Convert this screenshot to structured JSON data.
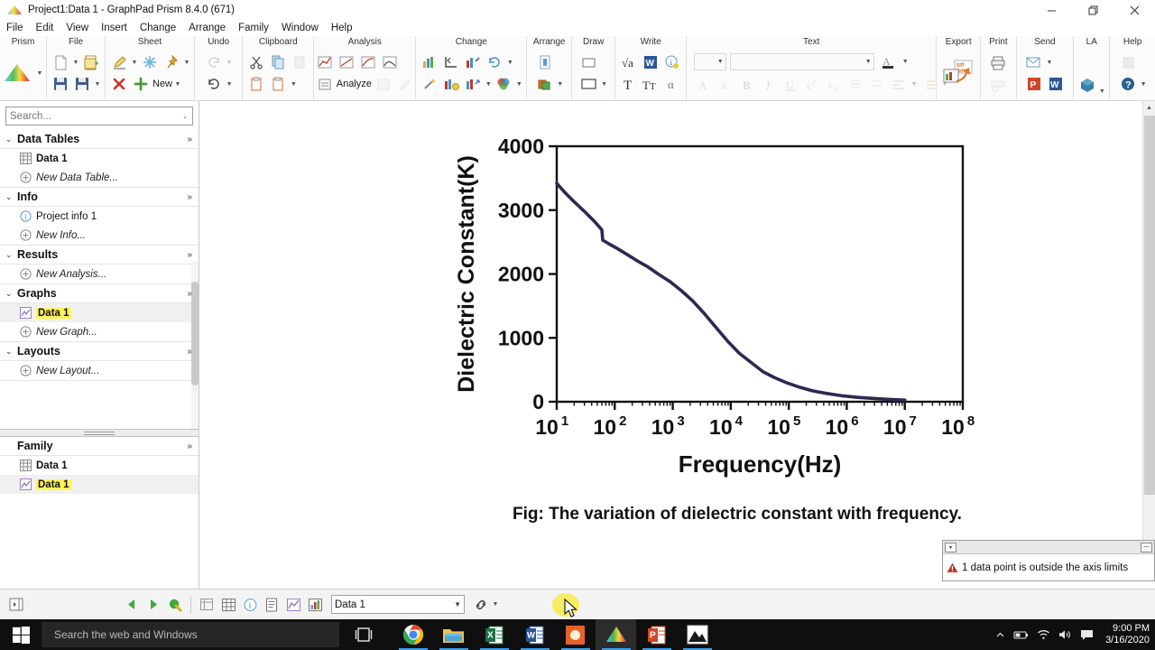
{
  "window": {
    "title": "Project1:Data 1 - GraphPad Prism 8.4.0 (671)",
    "minimize": "minimize-button",
    "restore": "restore-button",
    "close": "close-button"
  },
  "menubar": {
    "items": [
      "File",
      "Edit",
      "View",
      "Insert",
      "Change",
      "Arrange",
      "Family",
      "Window",
      "Help"
    ]
  },
  "ribbon": {
    "groups": [
      {
        "label": "Prism"
      },
      {
        "label": "File"
      },
      {
        "label": "Sheet",
        "new_label": "New"
      },
      {
        "label": "Undo"
      },
      {
        "label": "Clipboard"
      },
      {
        "label": "Analysis",
        "analyze_label": "Analyze"
      },
      {
        "label": "Change"
      },
      {
        "label": "Arrange"
      },
      {
        "label": "Draw"
      },
      {
        "label": "Write"
      },
      {
        "label": "Text"
      },
      {
        "label": "Export"
      },
      {
        "label": "Print"
      },
      {
        "label": "Send"
      },
      {
        "label": "LA"
      },
      {
        "label": "Help"
      }
    ],
    "font_name_value": "",
    "font_size_value": ""
  },
  "navigator": {
    "search": {
      "placeholder": "Search...",
      "value": ""
    },
    "sections": [
      {
        "title": "Data Tables",
        "rows": [
          {
            "label": "Data 1",
            "icon": "table-icon",
            "style": "bold"
          },
          {
            "label": "New Data Table...",
            "icon": "plus-circle-icon",
            "style": "new"
          }
        ]
      },
      {
        "title": "Info",
        "rows": [
          {
            "label": "Project info 1",
            "icon": "info-circle-icon",
            "style": "normal"
          },
          {
            "label": "New Info...",
            "icon": "plus-circle-icon",
            "style": "new"
          }
        ]
      },
      {
        "title": "Results",
        "rows": [
          {
            "label": "New Analysis...",
            "icon": "plus-circle-icon",
            "style": "new"
          }
        ]
      },
      {
        "title": "Graphs",
        "rows": [
          {
            "label": "Data 1",
            "icon": "graph-icon",
            "style": "highlighted"
          },
          {
            "label": "New Graph...",
            "icon": "plus-circle-icon",
            "style": "new"
          }
        ]
      },
      {
        "title": "Layouts",
        "rows": [
          {
            "label": "New Layout...",
            "icon": "plus-circle-icon",
            "style": "new"
          }
        ]
      }
    ],
    "family": {
      "title": "Family",
      "rows": [
        {
          "label": "Data 1",
          "icon": "table-icon",
          "style": "bold"
        },
        {
          "label": "Data 1",
          "icon": "graph-icon",
          "style": "highlighted"
        }
      ]
    }
  },
  "chart_data": {
    "type": "line",
    "title": "",
    "caption": "Fig: The variation of dielectric constant with frequency.",
    "xlabel": "Frequency(Hz)",
    "ylabel": "Dielectric Constant(K)",
    "xscale": "log",
    "xlim": [
      10,
      100000000
    ],
    "ylim": [
      0,
      4000
    ],
    "xtick_labels": [
      "10",
      "10",
      "10",
      "10",
      "10",
      "10",
      "10",
      "10"
    ],
    "xtick_exponents": [
      "1",
      "2",
      "3",
      "4",
      "5",
      "6",
      "7",
      "8"
    ],
    "ytick_labels": [
      "0",
      "1000",
      "2000",
      "3000",
      "4000"
    ],
    "ytick_values": [
      0,
      1000,
      2000,
      3000,
      4000
    ],
    "grid": false,
    "legend": false,
    "line_color": "#2e2851",
    "line_width": 3,
    "series": [
      {
        "name": "Dielectric Constant",
        "x": [
          10,
          14,
          20,
          30,
          45,
          60,
          62,
          80,
          110,
          160,
          240,
          360,
          560,
          900,
          1400,
          2200,
          3500,
          5600,
          9000,
          14000,
          22000,
          36000,
          56000,
          90000,
          150000,
          260000,
          450000,
          800000,
          1500000,
          3000000,
          6000000,
          10000000
        ],
        "y": [
          3420,
          3270,
          3130,
          2980,
          2820,
          2690,
          2530,
          2470,
          2400,
          2310,
          2210,
          2120,
          2000,
          1880,
          1740,
          1580,
          1380,
          1160,
          940,
          760,
          620,
          470,
          380,
          300,
          230,
          170,
          130,
          95,
          70,
          50,
          35,
          25
        ]
      }
    ]
  },
  "statusbar": {
    "sheet_selector_value": "Data 1",
    "icons": [
      "collapse-navigator-icon",
      "previous-sheet-icon",
      "next-sheet-icon",
      "family-icon",
      "spreadsheet-icon",
      "data-table-icon",
      "info-sheet-icon",
      "results-sheet-icon",
      "graph-sheet-icon",
      "layout-sheet-icon",
      "link-icon"
    ]
  },
  "warning": {
    "text": "1 data point is outside the axis limits",
    "icon": "warning-triangle-icon"
  },
  "taskbar": {
    "search_placeholder": "Search the web and Windows",
    "apps": [
      "task-view-icon",
      "chrome-icon",
      "file-explorer-icon",
      "excel-icon",
      "word-icon",
      "orange-app-icon",
      "prism-icon",
      "powerpoint-icon",
      "photos-icon"
    ],
    "tray": [
      "show-hidden-icons",
      "battery-icon",
      "wifi-icon",
      "volume-icon",
      "action-center-icon"
    ],
    "clock_time": "9:00 PM",
    "clock_date": "3/16/2020"
  }
}
